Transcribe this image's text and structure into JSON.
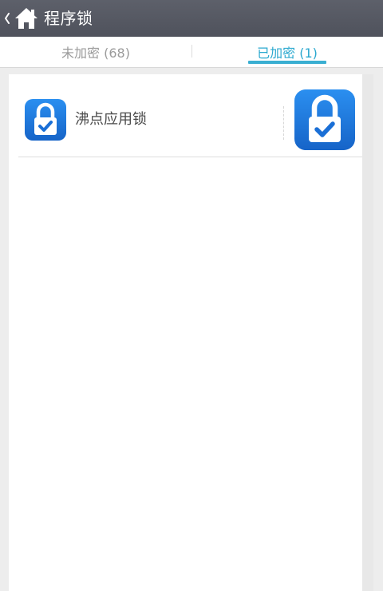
{
  "header": {
    "title": "程序锁",
    "back_icon": "chevron-left-icon",
    "home_icon": "home-icon"
  },
  "tabs": [
    {
      "label": "未加密 (68)",
      "active": false
    },
    {
      "label": "已加密 (1)",
      "active": true
    }
  ],
  "apps": [
    {
      "name": "沸点应用锁",
      "icon": "lock-check-icon",
      "locked": true
    }
  ],
  "colors": {
    "titlebar": "#575a64",
    "accent": "#2aa8cf",
    "icon_blue": "#1f7fe0"
  }
}
